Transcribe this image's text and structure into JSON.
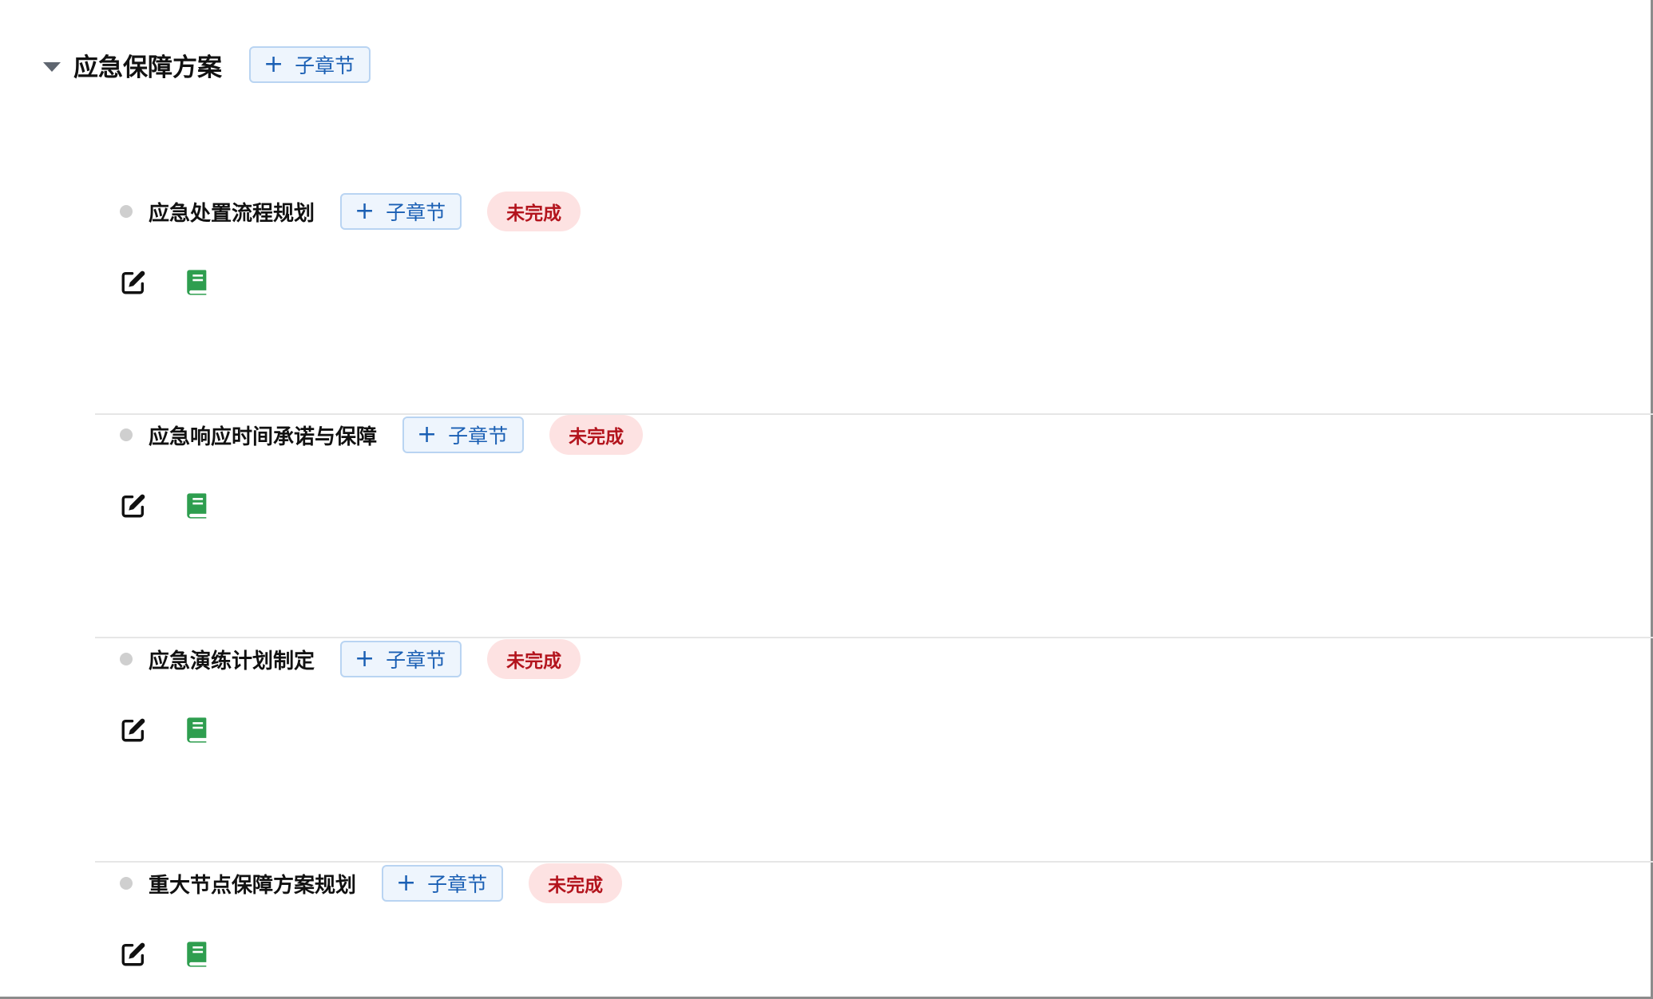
{
  "section": {
    "title": "应急保障方案",
    "add_label": "子章节",
    "add_symbol": "+"
  },
  "items": [
    {
      "title": "应急处置流程规划",
      "add_label": "子章节",
      "add_symbol": "+",
      "status": "未完成"
    },
    {
      "title": "应急响应时间承诺与保障",
      "add_label": "子章节",
      "add_symbol": "+",
      "status": "未完成"
    },
    {
      "title": "应急演练计划制定",
      "add_label": "子章节",
      "add_symbol": "+",
      "status": "未完成"
    },
    {
      "title": "重大节点保障方案规划",
      "add_label": "子章节",
      "add_symbol": "+",
      "status": "未完成"
    }
  ],
  "colors": {
    "accent": "#1a5fb4",
    "status_bg": "#fde2e2",
    "status_text": "#b3141d",
    "doc_icon": "#2e9e4f"
  },
  "icons": [
    "caret-down-icon",
    "plus-icon",
    "edit-icon",
    "document-icon"
  ]
}
